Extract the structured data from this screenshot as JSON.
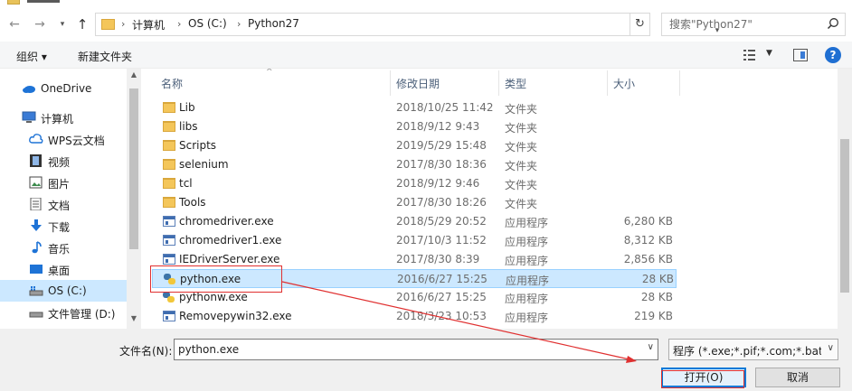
{
  "address": {
    "crumbs": [
      "计算机",
      "OS (C:)",
      "Python27"
    ],
    "separator": "›"
  },
  "search": {
    "placeholder": "搜索\"Python27\""
  },
  "toolbar": {
    "organize_label": "组织 ▾",
    "new_folder_label": "新建文件夹"
  },
  "nav_pane": {
    "items": [
      {
        "label": "OneDrive",
        "icon": "cloud-icon"
      },
      {
        "label": "计算机",
        "icon": "computer-icon"
      },
      {
        "label": "WPS云文档",
        "icon": "wps-cloud-icon"
      },
      {
        "label": "视频",
        "icon": "video-icon"
      },
      {
        "label": "图片",
        "icon": "picture-icon"
      },
      {
        "label": "文档",
        "icon": "document-icon"
      },
      {
        "label": "下载",
        "icon": "download-icon"
      },
      {
        "label": "音乐",
        "icon": "music-icon"
      },
      {
        "label": "桌面",
        "icon": "desktop-icon"
      },
      {
        "label": "OS (C:)",
        "icon": "drive-icon",
        "selected": true
      },
      {
        "label": "文件管理 (D:)",
        "icon": "drive-icon"
      }
    ]
  },
  "file_list": {
    "columns": {
      "name": "名称",
      "date": "修改日期",
      "type": "类型",
      "size": "大小"
    },
    "rows": [
      {
        "name": "Lib",
        "date": "2018/10/25 11:42",
        "type": "文件夹",
        "size": "",
        "icon": "folder-icon"
      },
      {
        "name": "libs",
        "date": "2018/9/12 9:43",
        "type": "文件夹",
        "size": "",
        "icon": "folder-icon"
      },
      {
        "name": "Scripts",
        "date": "2019/5/29 15:48",
        "type": "文件夹",
        "size": "",
        "icon": "folder-icon"
      },
      {
        "name": "selenium",
        "date": "2017/8/30 18:36",
        "type": "文件夹",
        "size": "",
        "icon": "folder-icon"
      },
      {
        "name": "tcl",
        "date": "2018/9/12 9:46",
        "type": "文件夹",
        "size": "",
        "icon": "folder-icon"
      },
      {
        "name": "Tools",
        "date": "2017/8/30 18:26",
        "type": "文件夹",
        "size": "",
        "icon": "folder-icon"
      },
      {
        "name": "chromedriver.exe",
        "date": "2018/5/29 20:52",
        "type": "应用程序",
        "size": "6,280 KB",
        "icon": "exe-icon"
      },
      {
        "name": "chromedriver1.exe",
        "date": "2017/10/3 11:52",
        "type": "应用程序",
        "size": "8,312 KB",
        "icon": "exe-icon"
      },
      {
        "name": "IEDriverServer.exe",
        "date": "2017/8/30 8:39",
        "type": "应用程序",
        "size": "2,856 KB",
        "icon": "exe-icon"
      },
      {
        "name": "python.exe",
        "date": "2016/6/27 15:25",
        "type": "应用程序",
        "size": "28 KB",
        "icon": "python-icon",
        "selected": true
      },
      {
        "name": "pythonw.exe",
        "date": "2016/6/27 15:25",
        "type": "应用程序",
        "size": "28 KB",
        "icon": "python-icon"
      },
      {
        "name": "Removepywin32.exe",
        "date": "2018/3/23 10:53",
        "type": "应用程序",
        "size": "219 KB",
        "icon": "exe-icon"
      }
    ]
  },
  "bottom": {
    "filename_label": "文件名(N):",
    "filename_value": "python.exe",
    "filetype_value": "程序 (*.exe;*.pif;*.com;*.bat;*.",
    "open_label": "打开(O)",
    "cancel_label": "取消"
  },
  "colors": {
    "selection": "#cce8ff",
    "annotation": "#e03030",
    "accent": "#0078d7"
  }
}
